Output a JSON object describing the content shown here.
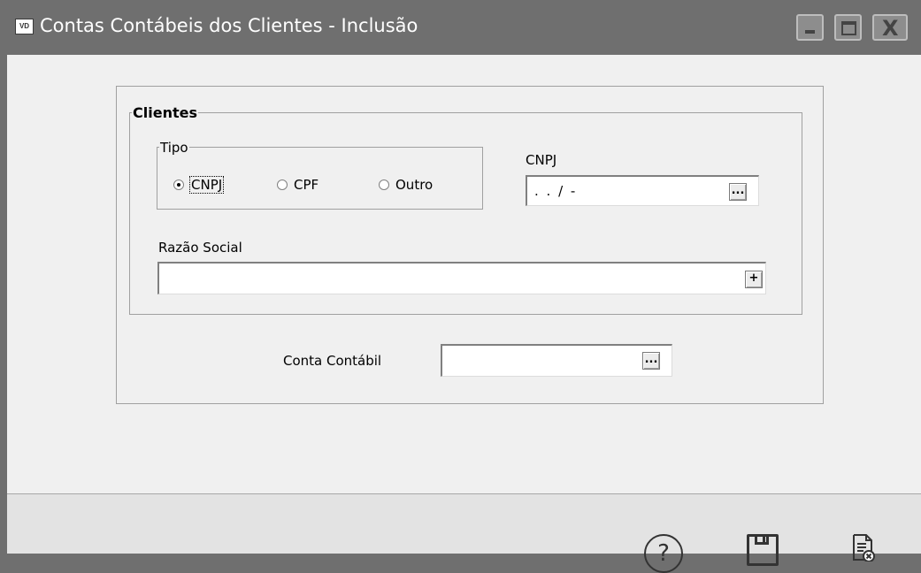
{
  "window": {
    "title": "Contas Contábeis dos Clientes - Inclusão",
    "app_icon": "VD",
    "controls": {
      "close": "X"
    }
  },
  "clientes": {
    "group_label": "Clientes",
    "tipo": {
      "label": "Tipo",
      "options": [
        {
          "label": "CNPJ",
          "selected": true
        },
        {
          "label": "CPF",
          "selected": false
        },
        {
          "label": "Outro",
          "selected": false
        }
      ]
    },
    "cnpj": {
      "label": "CNPJ",
      "value": ". . /  -",
      "button": "..."
    },
    "razao_social": {
      "label": "Razão Social",
      "value": "",
      "button": "+"
    }
  },
  "conta_contabil": {
    "label": "Conta Contábil",
    "value": "",
    "button": "..."
  },
  "footer": {
    "help_icon": "question-icon",
    "help_glyph": "?",
    "save_icon": "floppy-disk-icon",
    "cancel_icon": "document-cancel-icon"
  }
}
